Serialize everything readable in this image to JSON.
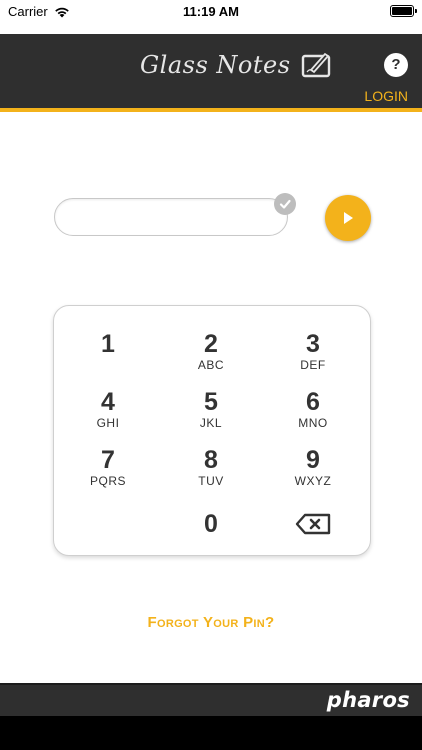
{
  "status_bar": {
    "carrier": "Carrier",
    "time": "11:19 AM"
  },
  "header": {
    "app_title": "Glass Notes",
    "help_label": "?",
    "login_label": "LOGIN",
    "accent_color": "#f3b21b"
  },
  "pin": {
    "value": "",
    "placeholder": ""
  },
  "keypad": {
    "keys": [
      {
        "digit": "1",
        "letters": ""
      },
      {
        "digit": "2",
        "letters": "ABC"
      },
      {
        "digit": "3",
        "letters": "DEF"
      },
      {
        "digit": "4",
        "letters": "GHI"
      },
      {
        "digit": "5",
        "letters": "JKL"
      },
      {
        "digit": "6",
        "letters": "MNO"
      },
      {
        "digit": "7",
        "letters": "PQRS"
      },
      {
        "digit": "8",
        "letters": "TUV"
      },
      {
        "digit": "9",
        "letters": "WXYZ"
      },
      {
        "digit": "0",
        "letters": ""
      }
    ]
  },
  "forgot_label": "Forgot Your Pin?",
  "footer": {
    "brand": "pharos"
  }
}
